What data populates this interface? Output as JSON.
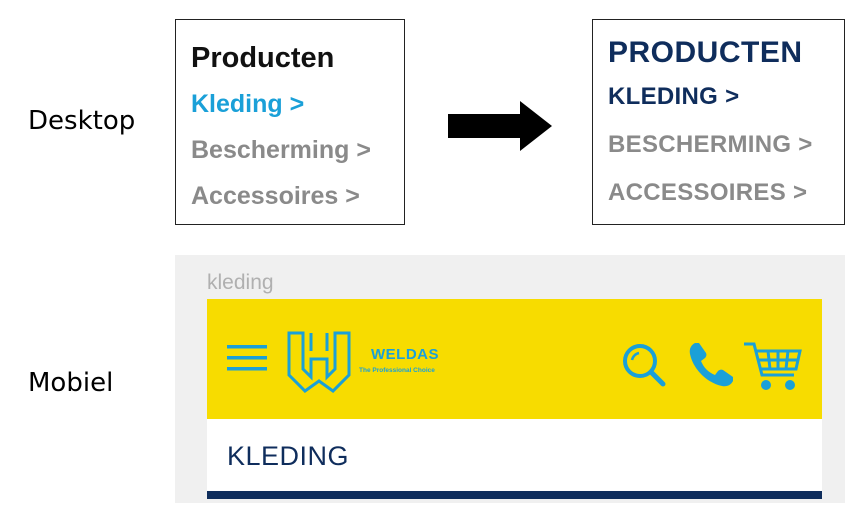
{
  "labels": {
    "desktop": "Desktop",
    "mobile": "Mobiel"
  },
  "desktop_before": {
    "title": "Producten",
    "items": [
      {
        "label": "Kleding >",
        "active": true
      },
      {
        "label": "Bescherming >",
        "active": false
      },
      {
        "label": "Accessoires >",
        "active": false
      }
    ]
  },
  "desktop_after": {
    "title": "PRODUCTEN",
    "items": [
      {
        "label": "KLEDING >",
        "active": true
      },
      {
        "label": "BESCHERMING >",
        "active": false
      },
      {
        "label": "ACCESSOIRES >",
        "active": false
      }
    ]
  },
  "mobile": {
    "breadcrumb": "kleding",
    "logo_name": "WELDAS",
    "logo_tagline": "The Professional Choice",
    "section_title": "KLEDING"
  },
  "icons": {
    "arrow": "right-arrow-icon",
    "menu": "hamburger-icon",
    "logo": "weldas-logo-icon",
    "search": "search-icon",
    "phone": "phone-icon",
    "cart": "cart-icon"
  },
  "colors": {
    "header_yellow": "#f7dc00",
    "brand_blue": "#1aa0d8",
    "navy": "#0f2d5c",
    "inactive_gray": "#8a8a8a"
  }
}
